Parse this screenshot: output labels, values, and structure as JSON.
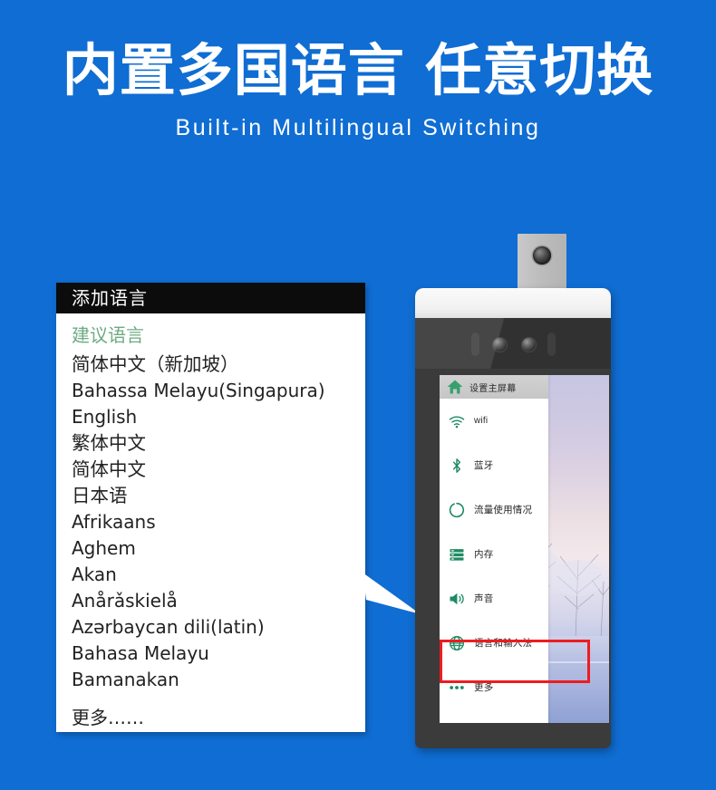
{
  "theme": {
    "background_blue": "#0f6dd3",
    "accent_green": "#1e8a63",
    "suggest_green": "#6eab83",
    "highlight_red": "#ee1c20",
    "header_black": "#0c0c0c"
  },
  "header": {
    "title": "内置多国语言 任意切换",
    "subtitle": "Built-in Multilingual Switching"
  },
  "language_panel": {
    "title": "添加语言",
    "suggested_label": "建议语言",
    "languages": [
      "简体中文（新加坡）",
      "Bahassa Melayu(Singapura)",
      "English",
      "繁体中文",
      "简体中文",
      "日本语",
      "Afrikaans",
      "Aghem",
      "Akan",
      "Anårǎskielå",
      "Azərbaycan dili(latin)",
      "Bahasa Melayu",
      "Bamanakan"
    ],
    "more_label": "更多……"
  },
  "device": {
    "settings_menu": {
      "header": {
        "label": "设置主屏幕",
        "icon": "home-icon"
      },
      "items": [
        {
          "label": "wifi",
          "icon": "wifi-icon",
          "latin": true
        },
        {
          "label": "蓝牙",
          "icon": "bluetooth-icon",
          "latin": false
        },
        {
          "label": "流量使用情况",
          "icon": "data-usage-icon",
          "latin": false
        },
        {
          "label": "内存",
          "icon": "storage-icon",
          "latin": false
        },
        {
          "label": "声音",
          "icon": "sound-icon",
          "latin": false
        },
        {
          "label": "语言和输入法",
          "icon": "globe-icon",
          "latin": false
        },
        {
          "label": "更多",
          "icon": "more-dots-icon",
          "latin": false
        }
      ],
      "highlighted_item": "语言和输入法"
    }
  }
}
